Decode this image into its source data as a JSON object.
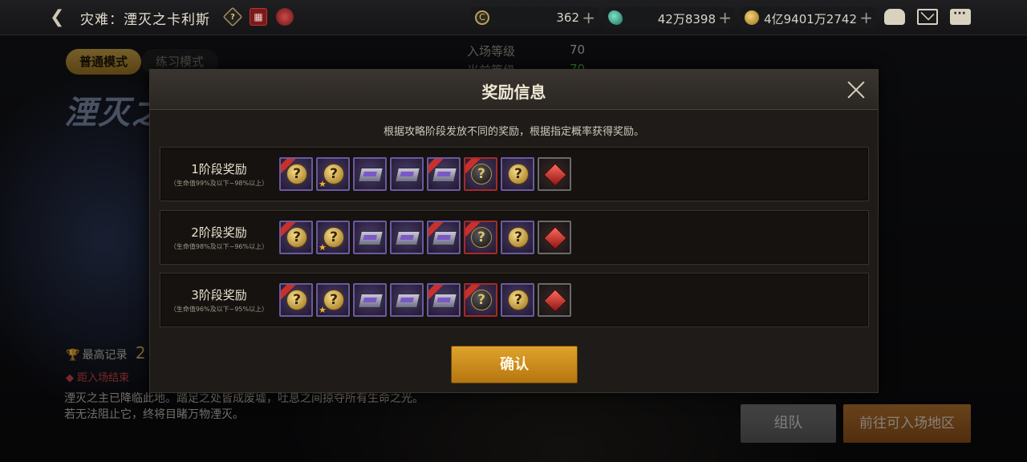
{
  "header": {
    "dungeon_title": "灾难：湮灭之卡利斯",
    "help_icon_glyph": "?",
    "resources": {
      "coin": {
        "icon": "coin-icon",
        "value": "362"
      },
      "gem": {
        "icon": "gem-icon",
        "value": "42万8398"
      },
      "gold": {
        "icon": "gold-icon",
        "value": "4亿9401万2742"
      },
      "plus": "+"
    }
  },
  "modes": {
    "normal": "普通模式",
    "practice": "练习模式"
  },
  "entry": {
    "level_label": "入场等级",
    "level_value": "70",
    "current_label": "当前等级",
    "current_value": "70"
  },
  "dungeon_logo": "湮灭之",
  "record": {
    "label": "最高记录",
    "value": "2"
  },
  "timer_text": "距入场结束",
  "story": "湮灭之主已降临此地。踏足之处皆成废墟，吐息之间掠夺所有生命之光。若无法阻止它，终将目睹万物湮灭。",
  "buttons": {
    "party": "组队",
    "go": "前往可入场地区"
  },
  "modal": {
    "title": "奖励信息",
    "description": "根据攻略阶段发放不同的奖励，根据指定概率获得奖励。",
    "confirm": "确认",
    "stages": [
      {
        "label": "1阶段奖励",
        "sub": "（生命值99%及以下~98%以上）"
      },
      {
        "label": "2阶段奖励",
        "sub": "（生命值98%及以下~96%以上）"
      },
      {
        "label": "3阶段奖励",
        "sub": "（生命值96%及以下~95%以上）"
      }
    ],
    "item_icons": [
      "mystery-coin-ribbon-icon",
      "mystery-coin-star-icon",
      "purple-box-icon",
      "purple-box-icon",
      "purple-box-ribbon-icon",
      "dark-mystery-coin-icon",
      "mystery-coin-icon",
      "red-gem-icon"
    ]
  }
}
